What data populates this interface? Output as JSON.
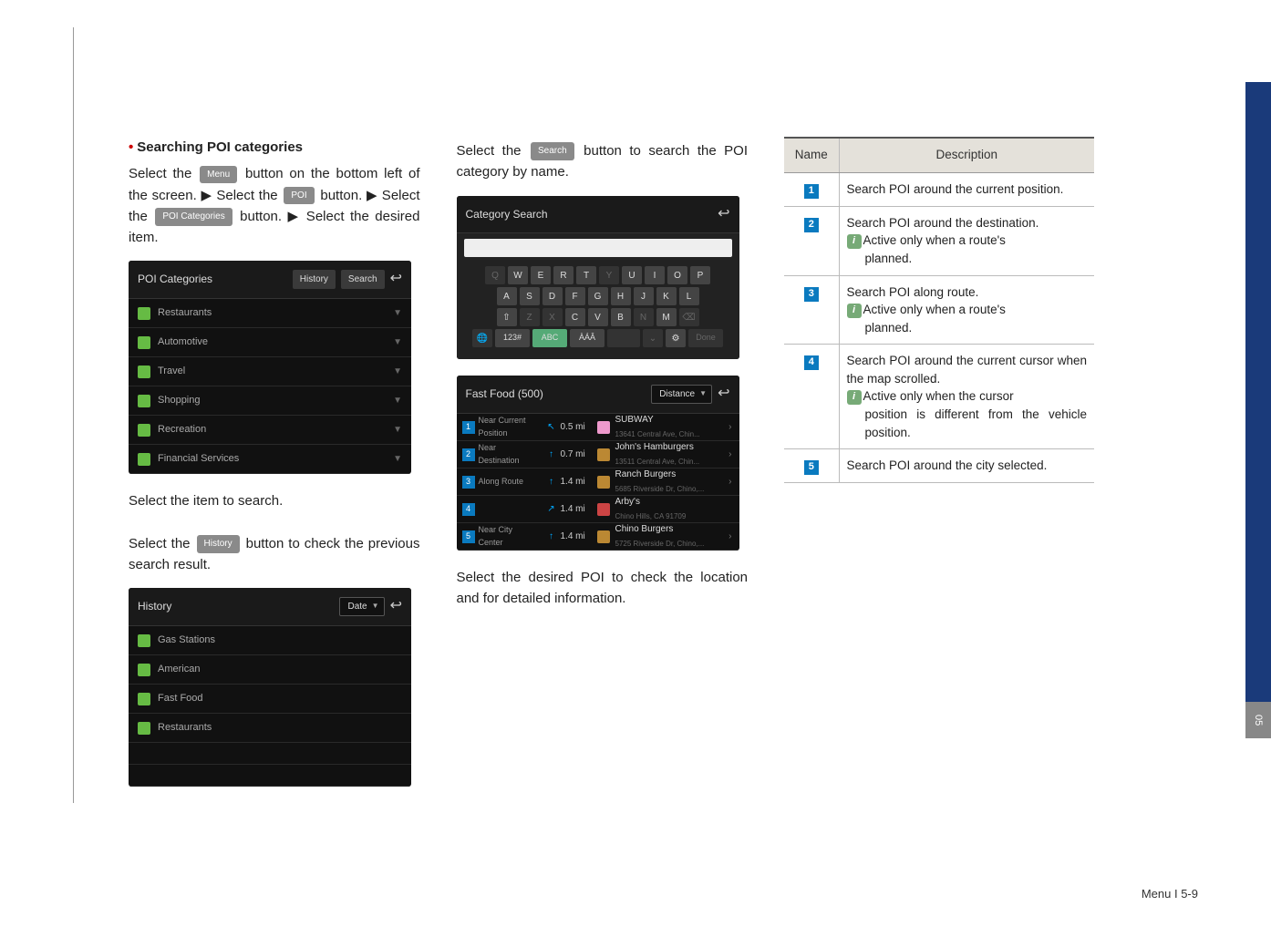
{
  "page": {
    "section_heading": "Searching POI categories",
    "footer": "Menu I 5-9",
    "side_chapter": "05"
  },
  "col1": {
    "p1_a": "Select the ",
    "menu_btn": "Menu",
    "p1_b": " button on the bottom left of the screen. ▶ Select the ",
    "poi_btn": "POI",
    "p1_c": " button. ▶ Select the ",
    "poicat_btn": "POI Categories",
    "p1_d": " button. ▶ Select the desired item.",
    "p2": "Select the item to search.",
    "p3_a": "Select the ",
    "history_btn": "History",
    "p3_b": " button to check the previous search result."
  },
  "ss_categories": {
    "title": "POI Categories",
    "history": "History",
    "search": "Search",
    "items": [
      "Restaurants",
      "Automotive",
      "Travel",
      "Shopping",
      "Recreation",
      "Financial Services"
    ]
  },
  "ss_history": {
    "title": "History",
    "sort": "Date",
    "items": [
      "Gas Stations",
      "American",
      "Fast Food",
      "Restaurants"
    ]
  },
  "col2": {
    "p1_a": "Select the ",
    "search_btn": "Search",
    "p1_b": " button to search the POI category by name.",
    "p2": "Select the desired POI to check the location and for detailed information."
  },
  "ss_search": {
    "title": "Category Search",
    "row1": [
      "Q",
      "W",
      "E",
      "R",
      "T",
      "Y",
      "U",
      "I",
      "O",
      "P"
    ],
    "row2": [
      "A",
      "S",
      "D",
      "F",
      "G",
      "H",
      "J",
      "K",
      "L"
    ],
    "row3_shift": "⇧",
    "row3": [
      "Z",
      "X",
      "C",
      "V",
      "B",
      "N",
      "M"
    ],
    "row3_del": "⌫",
    "row4": {
      "lang": "🌐",
      "num": "123#",
      "abc": "ABC",
      "accent": "ÀÁÂ",
      "space": " ",
      "hide": "⌄",
      "gear": "⚙",
      "done": "Done"
    }
  },
  "ss_results": {
    "title": "Fast Food (500)",
    "sort": "Distance",
    "sides": [
      "Near Current Position",
      "Near Destination",
      "Along Route",
      "",
      "Near City Center"
    ],
    "rows": [
      {
        "n": "1",
        "dist": "0.5 mi",
        "t1": "SUBWAY",
        "t2": "13641 Central Ave, Chin..."
      },
      {
        "n": "2",
        "dist": "0.7 mi",
        "t1": "John's Hamburgers",
        "t2": "13511 Central Ave, Chin..."
      },
      {
        "n": "3",
        "dist": "1.4 mi",
        "t1": "Ranch Burgers",
        "t2": "5685 Riverside Dr, Chino,..."
      },
      {
        "n": "4",
        "dist": "1.4 mi",
        "t1": "Arby's",
        "t2": "Chino Hills, CA 91709"
      },
      {
        "n": "5",
        "dist": "1.4 mi",
        "t1": "Chino Burgers",
        "t2": "5725 Riverside Dr, Chino,..."
      }
    ]
  },
  "table": {
    "h1": "Name",
    "h2": "Description",
    "rows": [
      {
        "n": "1",
        "desc": "Search POI around the current position."
      },
      {
        "n": "2",
        "desc": "Search POI around the destination.",
        "info": "Active only when a route's planned."
      },
      {
        "n": "3",
        "desc": "Search POI along route.",
        "info": "Active only when a route's planned."
      },
      {
        "n": "4",
        "desc": "Search POI around the current cursor when the map scrolled.",
        "info": "Active only when the cursor position is different from the vehicle position."
      },
      {
        "n": "5",
        "desc": "Search POI around the city selected."
      }
    ]
  }
}
